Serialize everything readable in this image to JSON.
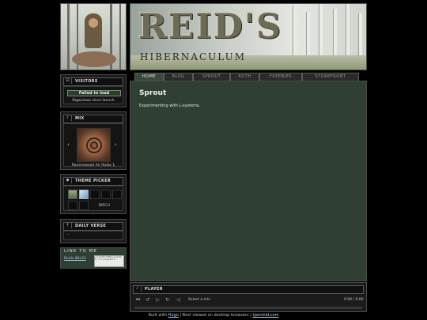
{
  "banner": {
    "title": "REID'S",
    "subtitle": "HIBERNACULUM"
  },
  "nav": {
    "tabs": [
      "HOME",
      "BLOG",
      "SPROUT",
      "ROTH",
      "FREEBIES",
      "STOREFRONT"
    ],
    "active": "HOME"
  },
  "visitors": {
    "title": "VISITORS",
    "status": "Failed to load",
    "caption": "Pageviews since launch"
  },
  "mix": {
    "title": "MIX",
    "prev": "‹",
    "next": "›",
    "station": "Ravenswood Air Radio 1"
  },
  "theme": {
    "title": "THEME PICKER",
    "selected": "BIRCH"
  },
  "verse": {
    "title": "DAILY VERSE",
    "text": "--"
  },
  "linkme": {
    "title": "LINK TO ME",
    "image_alt": "Reids 88x31",
    "code_text": "<a href=\"https://reidsh.../\"><img src=..."
  },
  "content": {
    "title": "Sprout",
    "body": "Experimenting with L-systems."
  },
  "player": {
    "title": "PLAYER",
    "track": "Select a mix",
    "time": "0:00 / 0:00"
  },
  "footer": {
    "built": "Built with",
    "hugo": "Hugo",
    "sep1": " | Best viewed on desktop browsers | ",
    "site": "tjammid.com"
  },
  "colors": {
    "content_bg": "#2f3f33",
    "page_bg": "#000000"
  }
}
